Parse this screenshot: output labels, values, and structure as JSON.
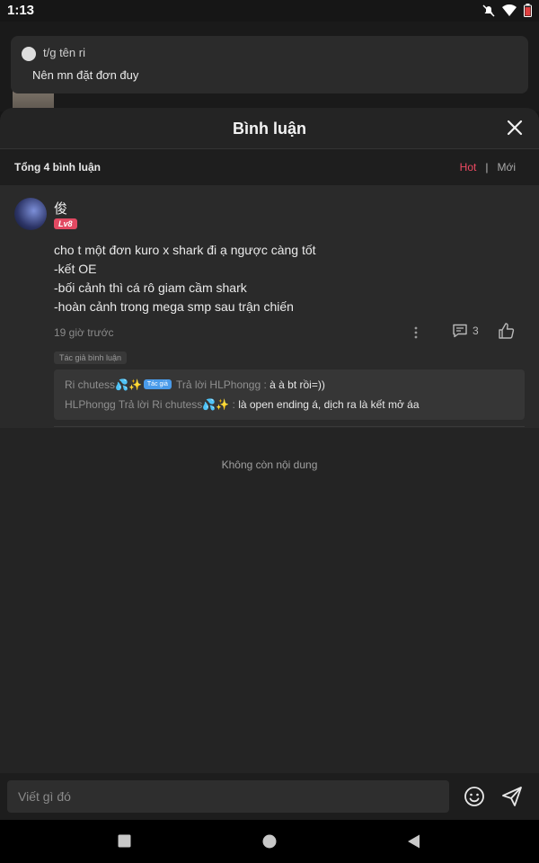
{
  "status_bar": {
    "time": "1:13"
  },
  "toast": {
    "name": "t/g tên ri",
    "message": "Nên mn đặt đơn đuy"
  },
  "sheet": {
    "title": "Bình luận",
    "total": "Tổng 4 bình luận",
    "sort": {
      "hot": "Hot",
      "separator": "|",
      "new": "Mới"
    }
  },
  "comment": {
    "username": "俊",
    "level": "Lv8",
    "lines": [
      "cho t một đơn kuro x shark đi ạ ngược càng tốt",
      "-kết OE",
      "-bối cảnh thì cá rô giam cầm shark",
      "-hoàn cảnh trong mega smp sau trận chiến"
    ],
    "time": "19 giờ trước",
    "reply_count": "3",
    "author_tag": "Tác giả bình luận",
    "replies": [
      {
        "author": "Ri chutess💦✨",
        "badge": "Tác giả",
        "action": "Trả lời HLPhongg :",
        "text": "à à bt rồi=))"
      },
      {
        "author": "HLPhongg",
        "action": "Trả lời Ri chutess💦✨ :",
        "text": "là open ending á, dịch ra là kết mở áa"
      }
    ]
  },
  "no_more": "Không còn nội dung",
  "composer": {
    "placeholder": "Viết gì đó"
  },
  "colors": {
    "accent": "#ee4a62",
    "badge": "#4a9bea",
    "sheet_bg": "#242424"
  },
  "icons": [
    "mute-icon",
    "wifi-icon",
    "battery-icon",
    "close-icon",
    "more-icon",
    "comment-icon",
    "like-icon",
    "emoji-icon",
    "send-icon",
    "square-nav-icon",
    "circle-nav-icon",
    "back-nav-icon"
  ]
}
